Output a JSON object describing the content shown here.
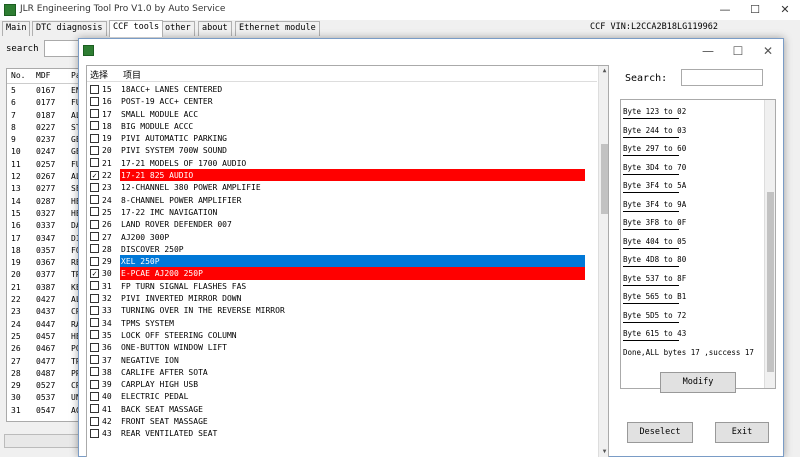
{
  "window": {
    "title": "JLR Engineering Tool Pro V1.0 by Auto Service",
    "minimize": "—",
    "maximize": "☐",
    "close": "✕"
  },
  "tabs": [
    "Main",
    "DTC diagnosis",
    "CCF tools",
    "other",
    "about",
    "Ethernet module"
  ],
  "vin": "CCF VIN:L2CCA2B18LG119962",
  "main_search": {
    "label": "search",
    "value": ""
  },
  "grid": {
    "headers": [
      "No.",
      "MDF",
      "Pa"
    ],
    "rows": [
      [
        "5",
        "0167",
        "EN"
      ],
      [
        "6",
        "0177",
        "FU"
      ],
      [
        "7",
        "0187",
        "AL"
      ],
      [
        "8",
        "0227",
        "ST"
      ],
      [
        "9",
        "0237",
        "GE"
      ],
      [
        "10",
        "0247",
        "GE"
      ],
      [
        "11",
        "0257",
        "FU"
      ],
      [
        "12",
        "0267",
        "AL"
      ],
      [
        "13",
        "0277",
        "SE"
      ],
      [
        "14",
        "0287",
        "HE"
      ],
      [
        "15",
        "0327",
        "HE"
      ],
      [
        "16",
        "0337",
        "DA"
      ],
      [
        "17",
        "0347",
        "DI"
      ],
      [
        "18",
        "0357",
        "FO"
      ],
      [
        "19",
        "0367",
        "RE"
      ],
      [
        "20",
        "0377",
        "TR"
      ],
      [
        "21",
        "0387",
        "KE"
      ],
      [
        "22",
        "0427",
        "AL"
      ],
      [
        "23",
        "0437",
        "CR"
      ],
      [
        "24",
        "0447",
        "RA"
      ],
      [
        "25",
        "0457",
        "HE"
      ],
      [
        "26",
        "0467",
        "PO"
      ],
      [
        "27",
        "0477",
        "TR"
      ],
      [
        "28",
        "0487",
        "PR"
      ],
      [
        "29",
        "0527",
        "CR"
      ],
      [
        "30",
        "0537",
        "UN"
      ],
      [
        "31",
        "0547",
        "AC"
      ]
    ]
  },
  "dialog": {
    "title_controls": {
      "minimize": "—",
      "maximize": "☐",
      "close": "✕"
    },
    "list_headers": {
      "select": "选择",
      "item": "项目"
    },
    "items": [
      {
        "num": "15",
        "name": "18ACC+ LANES CENTERED",
        "checked": false,
        "hl": ""
      },
      {
        "num": "16",
        "name": "POST-19 ACC+ CENTER",
        "checked": false,
        "hl": ""
      },
      {
        "num": "17",
        "name": "SMALL MODULE ACC",
        "checked": false,
        "hl": ""
      },
      {
        "num": "18",
        "name": "BIG MODULE ACCC",
        "checked": false,
        "hl": ""
      },
      {
        "num": "19",
        "name": "PIVI AUTOMATIC PARKING",
        "checked": false,
        "hl": ""
      },
      {
        "num": "20",
        "name": "PIVI SYSTEM 700W SOUND",
        "checked": false,
        "hl": ""
      },
      {
        "num": "21",
        "name": "17-21 MODELS OF 1700 AUDIO",
        "checked": false,
        "hl": ""
      },
      {
        "num": "22",
        "name": "17-21 825 AUDIO",
        "checked": true,
        "hl": "red"
      },
      {
        "num": "23",
        "name": "12-CHANNEL 380 POWER AMPLIFIE",
        "checked": false,
        "hl": ""
      },
      {
        "num": "24",
        "name": "8-CHANNEL POWER AMPLIFIER",
        "checked": false,
        "hl": ""
      },
      {
        "num": "25",
        "name": "17-22 IMC NAVIGATION",
        "checked": false,
        "hl": ""
      },
      {
        "num": "26",
        "name": "LAND ROVER DEFENDER 007",
        "checked": false,
        "hl": ""
      },
      {
        "num": "27",
        "name": "AJ200 300P",
        "checked": false,
        "hl": ""
      },
      {
        "num": "28",
        "name": "DISCOVER  250P",
        "checked": false,
        "hl": ""
      },
      {
        "num": "29",
        "name": "XEL 250P",
        "checked": false,
        "hl": "blue"
      },
      {
        "num": "30",
        "name": "E-PCAE AJ200 250P",
        "checked": true,
        "hl": "red"
      },
      {
        "num": "31",
        "name": "FP TURN SIGNAL FLASHES FAS",
        "checked": false,
        "hl": ""
      },
      {
        "num": "32",
        "name": "PIVI INVERTED MIRROR DOWN",
        "checked": false,
        "hl": ""
      },
      {
        "num": "33",
        "name": "TURNING OVER IN THE REVERSE MIRROR",
        "checked": false,
        "hl": ""
      },
      {
        "num": "34",
        "name": "  TPMS SYSTEM",
        "checked": false,
        "hl": ""
      },
      {
        "num": "35",
        "name": "LOCK OFF STEERING COLUMN",
        "checked": false,
        "hl": ""
      },
      {
        "num": "36",
        "name": "ONE-BUTTON WINDOW LIFT",
        "checked": false,
        "hl": ""
      },
      {
        "num": "37",
        "name": "NEGATIVE ION",
        "checked": false,
        "hl": ""
      },
      {
        "num": "38",
        "name": "CARLIFE AFTER SOTA",
        "checked": false,
        "hl": ""
      },
      {
        "num": "39",
        "name": "CARPLAY HIGH USB",
        "checked": false,
        "hl": ""
      },
      {
        "num": "40",
        "name": "ELECTRIC PEDAL",
        "checked": false,
        "hl": ""
      },
      {
        "num": "41",
        "name": "BACK SEAT MASSAGE",
        "checked": false,
        "hl": ""
      },
      {
        "num": "42",
        "name": "FRONT SEAT MASSAGE",
        "checked": false,
        "hl": ""
      },
      {
        "num": "43",
        "name": "REAR VENTILATED SEAT",
        "checked": false,
        "hl": ""
      }
    ],
    "search": {
      "label": "Search:",
      "value": ""
    },
    "log": [
      "Byte  123 to  02",
      "Byte  244 to  03",
      "Byte  297 to  60",
      "Byte  3D4 to  70",
      "Byte  3F4 to  5A",
      "Byte  3F4 to  9A",
      "Byte  3F8 to  0F",
      "Byte  404 to  05",
      "Byte  4D8 to  80",
      "Byte  537 to  8F",
      "Byte  565 to  B1",
      "Byte  5D5 to  72",
      "Byte  615 to  43",
      "Done,ALL bytes  17  ,success 17"
    ],
    "buttons": {
      "modify": "Modify",
      "deselect": "Deselect",
      "exit": "Exit"
    }
  },
  "colors": {
    "red_highlight": "#ff0000",
    "blue_highlight": "#0078d7",
    "icon": "#2e7d32"
  }
}
